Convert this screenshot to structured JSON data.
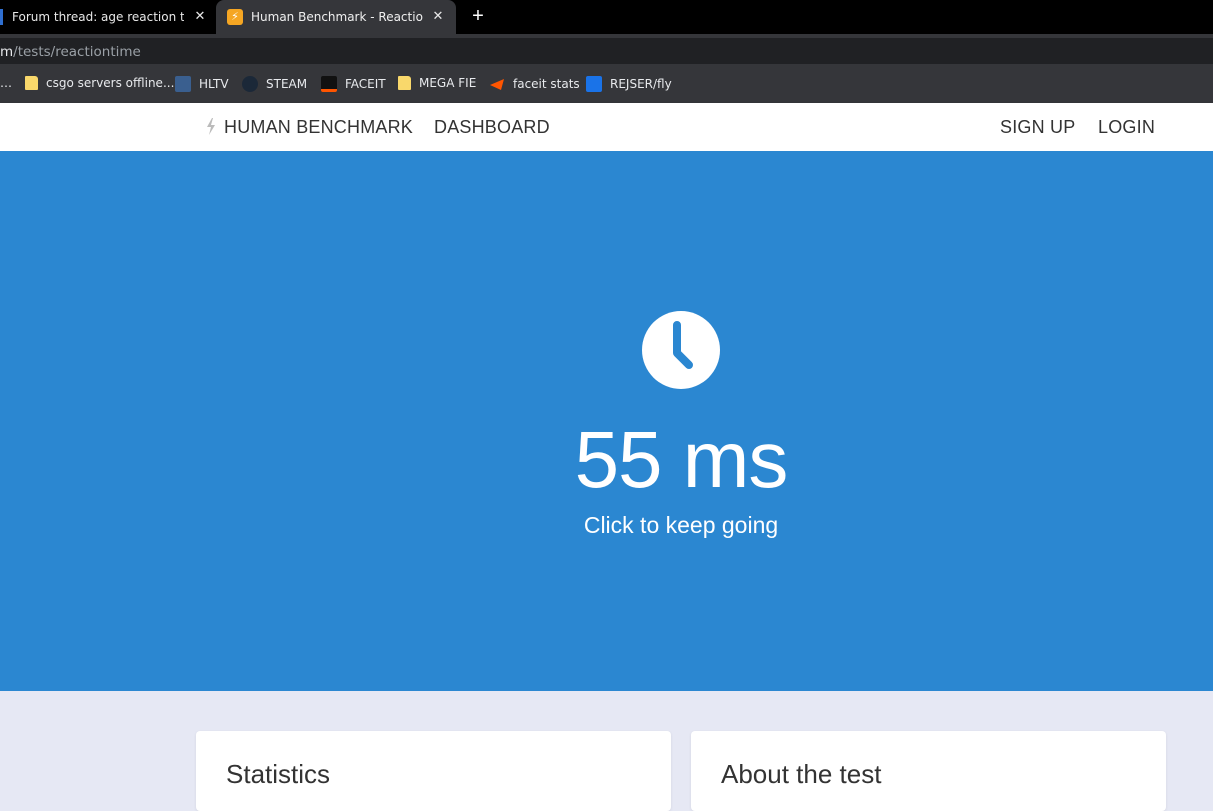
{
  "browser": {
    "tabs": [
      {
        "title": "Forum thread: age reaction time",
        "close": "✕"
      },
      {
        "title": "Human Benchmark - Reaction Time",
        "favicon": "⚡",
        "close": "✕"
      }
    ],
    "new_tab": "+",
    "url_host": "m",
    "url_path": "/tests/reactiontime",
    "bookmarks": [
      {
        "label": "…",
        "icon": "overflow"
      },
      {
        "label": "csgo servers offline...",
        "icon": "folder-icon"
      },
      {
        "label": "HLTV",
        "icon": "hltv-icon"
      },
      {
        "label": "STEAM",
        "icon": "steam-icon"
      },
      {
        "label": "FACEIT",
        "icon": "faceit-icon"
      },
      {
        "label": "MEGA FIE",
        "icon": "folder-icon"
      },
      {
        "label": "faceit stats",
        "icon": "faceit-icon"
      },
      {
        "label": "REJSER/fly",
        "icon": "plane-icon"
      }
    ]
  },
  "nav": {
    "brand": "HUMAN BENCHMARK",
    "dashboard": "DASHBOARD",
    "signup": "SIGN UP",
    "login": "LOGIN"
  },
  "hero": {
    "icon": "clock-icon",
    "result": "55 ms",
    "prompt": "Click to keep going",
    "background": "#2b87d1"
  },
  "cards": {
    "statistics": "Statistics",
    "about": "About the test"
  }
}
